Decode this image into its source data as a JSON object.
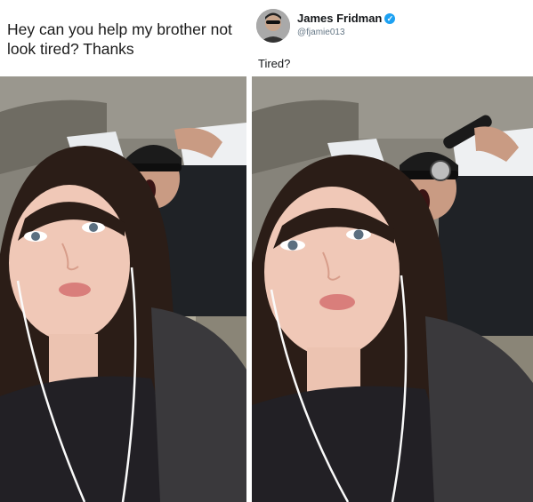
{
  "request": {
    "text": "Hey can you help my brother not look tired? Thanks"
  },
  "reply": {
    "author_name": "James Fridman",
    "author_handle": "@fjamie013",
    "verified_icon": "verified-badge-icon",
    "text": "Tired?"
  },
  "colors": {
    "verified": "#1da1f2",
    "car_interior": "#7d7a70",
    "hair": "#2b1d17"
  }
}
